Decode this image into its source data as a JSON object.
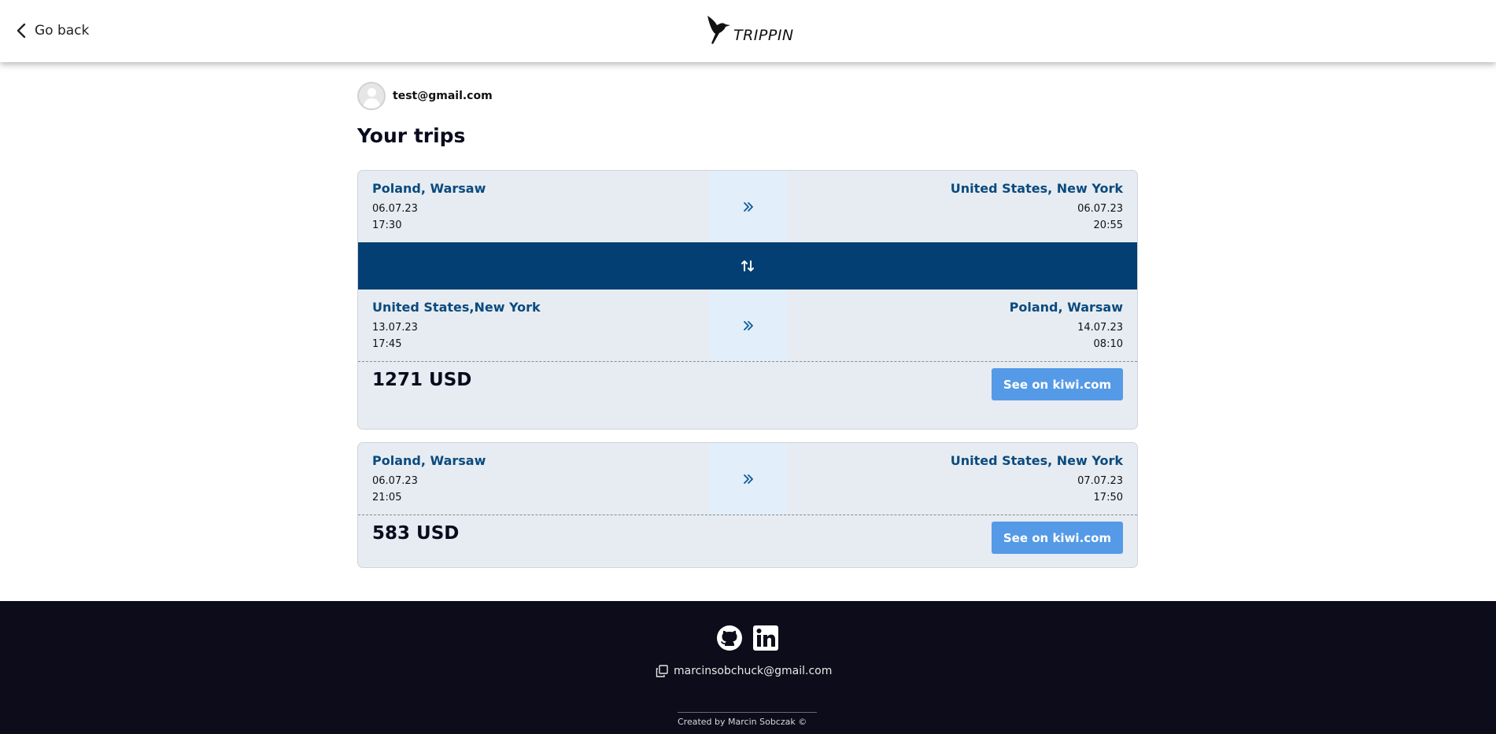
{
  "header": {
    "back_label": "Go back",
    "logo_text": "TRIPPIN"
  },
  "user": {
    "email": "test@gmail.com"
  },
  "page_title": "Your trips",
  "trips": [
    {
      "outbound": {
        "from_city": "Poland, Warsaw",
        "from_date": "06.07.23",
        "from_time": "17:30",
        "to_city": "United States, New York",
        "to_date": "06.07.23",
        "to_time": "20:55"
      },
      "return": {
        "from_city": "United States,New York",
        "from_date": "13.07.23",
        "from_time": "17:45",
        "to_city": "Poland, Warsaw",
        "to_date": "14.07.23",
        "to_time": "08:10"
      },
      "price": "1271 USD",
      "button_label": "See on kiwi.com"
    },
    {
      "outbound": {
        "from_city": "Poland, Warsaw",
        "from_date": "06.07.23",
        "from_time": "21:05",
        "to_city": "United States, New York",
        "to_date": "07.07.23",
        "to_time": "17:50"
      },
      "price": "583 USD",
      "button_label": "See on kiwi.com"
    }
  ],
  "footer": {
    "email": "marcinsobchuck@gmail.com",
    "credit": "Created by Marcin Sobczak ©"
  },
  "colors": {
    "primary": "#033f72",
    "city_text": "#0b4a7e",
    "button": "#559ae6",
    "card_bg": "#e6ecf1",
    "footer_bg": "#0c0c1a"
  },
  "icons": [
    "chevron-left-icon",
    "hummingbird-logo-icon",
    "double-chevron-right-icon",
    "swap-arrows-icon",
    "github-icon",
    "linkedin-icon",
    "copy-icon"
  ]
}
